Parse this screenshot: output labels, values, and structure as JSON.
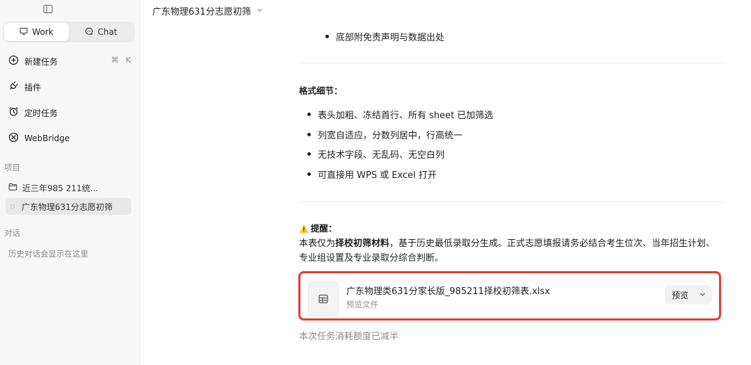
{
  "sidebar": {
    "modes": [
      {
        "label": "Work",
        "icon": "monitor-icon",
        "active": true
      },
      {
        "label": "Chat",
        "icon": "chat-bubble-icon",
        "active": false
      }
    ],
    "nav": [
      {
        "label": "新建任务",
        "icon": "plus-circle-icon"
      },
      {
        "label": "插件",
        "icon": "plug-icon"
      },
      {
        "label": "定时任务",
        "icon": "alarm-clock-icon"
      },
      {
        "label": "WebBridge",
        "icon": "compass-icon"
      }
    ],
    "new_task_shortcut": {
      "mod": "⌘",
      "key": "K"
    },
    "projects_label": "项目",
    "projects": [
      {
        "label": "近三年985 211统...",
        "icon": "folder-icon"
      },
      {
        "label": "广东物理631分志愿初筛",
        "selected": true
      }
    ],
    "history_label": "对话",
    "history_empty": "历史对话会显示在这里"
  },
  "header": {
    "title": "广东物理631分志愿初筛"
  },
  "content": {
    "top_bullet": "底部附免责声明与数据出处",
    "format_heading": "格式细节：",
    "format_bullets": [
      "表头加粗、冻结首行、所有 sheet 已加筛选",
      "列宽自适应，分数列居中，行高统一",
      "无技术字段、无乱码、无空白列",
      "可直接用 WPS 或 Excel 打开"
    ],
    "reminder_icon": "⚠️",
    "reminder_heading": "提醒：",
    "reminder_pre": "本表仅为",
    "reminder_bold": "择校初筛材料",
    "reminder_post": "，基于历史最低录取分生成。正式志愿填报请务必结合考生位次、当年招生计划、专业组设置及专业录取分综合判断。"
  },
  "file_card": {
    "name": "广东物理类631分家长版_985211择校初筛表.xlsx",
    "subtitle": "预览文件",
    "preview_label": "预览",
    "highlight_color": "#e53a2f"
  },
  "footer_note": "本次任务消耗额度已减半"
}
